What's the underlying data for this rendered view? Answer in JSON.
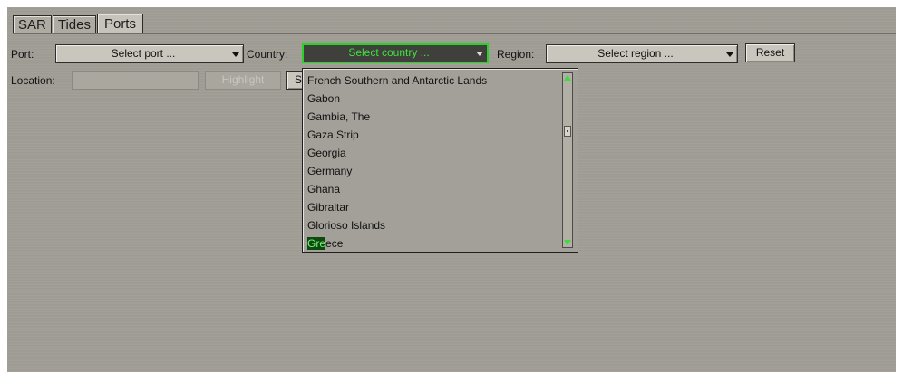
{
  "tabs": [
    {
      "label": "SAR"
    },
    {
      "label": "Tides"
    },
    {
      "label": "Ports"
    }
  ],
  "filters": {
    "port_label": "Port:",
    "port_value": "Select port ...",
    "country_label": "Country:",
    "country_value": "Select country ...",
    "region_label": "Region:",
    "region_value": "Select region ...",
    "reset_label": "Reset"
  },
  "location": {
    "label": "Location:",
    "value": "",
    "highlight_label": "Highlight",
    "search_label": "S"
  },
  "country_list": {
    "items": [
      "French Southern and Antarctic Lands",
      "Gabon",
      "Gambia, The",
      "Gaza Strip",
      "Georgia",
      "Germany",
      "Ghana",
      "Gibraltar",
      "Glorioso Islands"
    ],
    "last_item_match": "Gre",
    "last_item_rest": "ece"
  },
  "colors": {
    "accent_green": "#25d425",
    "panel": "#a09d95",
    "highlight_bg": "#0d4a0d"
  }
}
